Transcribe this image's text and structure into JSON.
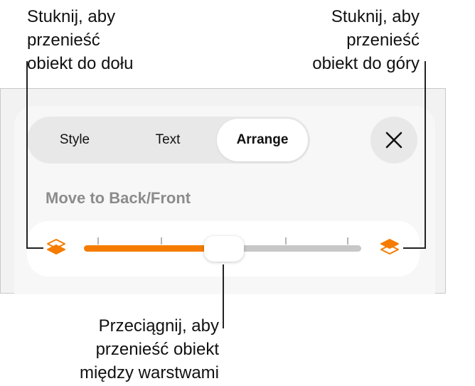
{
  "callouts": {
    "move_back": "Stuknij, aby\nprzenieść\nobiekt do dołu",
    "move_front": "Stuknij, aby\nprzenieść\nobiekt do góry",
    "drag": "Przeciągnij, aby\nprzenieść obiekt\nmiędzy warstwami"
  },
  "tabs": [
    {
      "label": "Style",
      "selected": false
    },
    {
      "label": "Text",
      "selected": false
    },
    {
      "label": "Arrange",
      "selected": true
    }
  ],
  "section": {
    "label": "Move to Back/Front"
  },
  "slider": {
    "value_fraction": 0.45,
    "tick_count": 5
  },
  "icons": {
    "close": "close-icon",
    "back": "layers-back-icon",
    "front": "layers-front-icon"
  },
  "colors": {
    "accent": "#f57c00",
    "track_inactive": "#c7c7c7",
    "label_gray": "#8c8c8c"
  }
}
